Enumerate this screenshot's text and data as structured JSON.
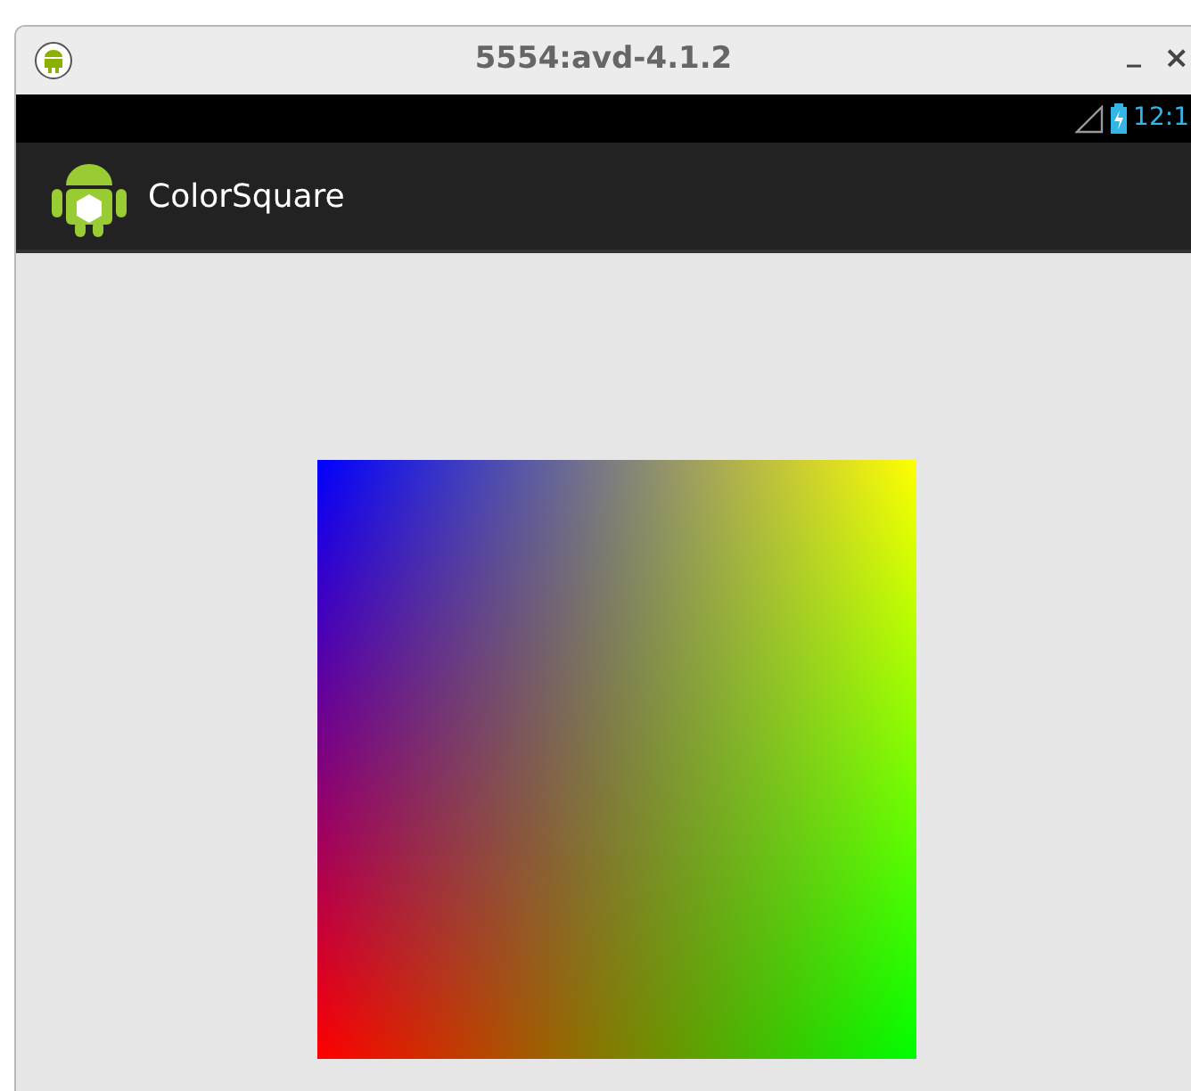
{
  "window": {
    "title": "5554:avd-4.1.2",
    "minimize": "_",
    "close": "×"
  },
  "status_bar": {
    "time": "12:1"
  },
  "action_bar": {
    "title": "ColorSquare"
  }
}
